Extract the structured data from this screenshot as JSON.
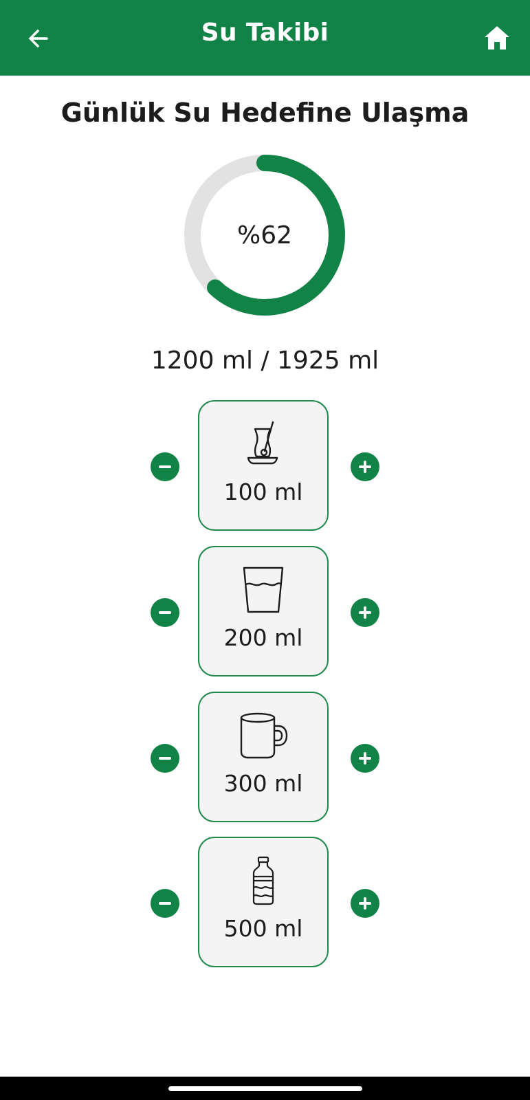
{
  "header": {
    "title": "Su Takibi",
    "back_icon": "arrow-left-icon",
    "home_icon": "home-icon",
    "bg_color": "#118347"
  },
  "goal": {
    "heading": "Günlük Su Hedefine Ulaşma",
    "percent_label": "%62",
    "percent_value": 62,
    "consumed_ml": 1200,
    "target_ml": 1925,
    "amount_label": "1200 ml / 1925 ml",
    "ring_color": "#118347",
    "track_color": "#e2e2e2"
  },
  "drinks": [
    {
      "id": "tea-glass",
      "icon": "tea-glass-icon",
      "label": "100 ml"
    },
    {
      "id": "water-glass",
      "icon": "water-glass-icon",
      "label": "200 ml"
    },
    {
      "id": "mug",
      "icon": "mug-icon",
      "label": "300 ml"
    },
    {
      "id": "bottle",
      "icon": "water-bottle-icon",
      "label": "500 ml"
    }
  ],
  "controls": {
    "minus_icon": "minus-circle-icon",
    "plus_icon": "plus-circle-icon"
  }
}
